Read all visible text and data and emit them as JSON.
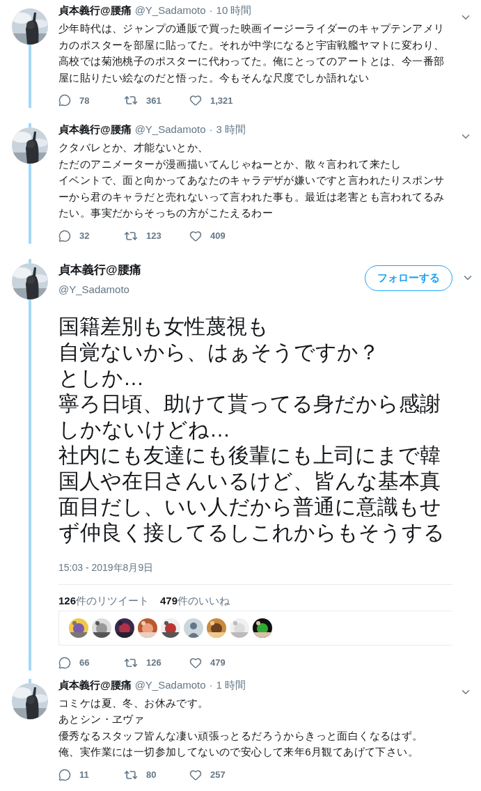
{
  "tweets": [
    {
      "kind": "reply",
      "name": "貞本義行@腰痛",
      "handle": "@Y_Sadamoto",
      "separator": "·",
      "time": "10 時間",
      "text": [
        "少年時代は、ジャンプの通販で買った映画イージーライダーのキャプテンアメリカのポスターを部屋に貼ってた。それが中学になると宇宙戦艦ヤマトに変わり、高校では菊池桃子のポスターに代わってた。俺にとってのアートとは、今一番部屋に貼りたい絵なのだと悟った。今もそんな尺度でしか語れない"
      ],
      "actions": {
        "replies": "78",
        "retweets": "361",
        "likes": "1,321"
      }
    },
    {
      "kind": "reply",
      "name": "貞本義行@腰痛",
      "handle": "@Y_Sadamoto",
      "separator": "·",
      "time": "3 時間",
      "text": [
        "クタバレとか、才能ないとか、",
        "ただのアニメーターが漫画描いてんじゃねーとか、散々言われて来たし",
        "イベントで、面と向かってあなたのキャラデザが嫌いですと言われたりスポンサーから君のキャラだと売れないって言われた事も。最近は老害とも言われてるみたい。事実だからそっちの方がこたえるわー"
      ],
      "actions": {
        "replies": "32",
        "retweets": "123",
        "likes": "409"
      }
    },
    {
      "kind": "main",
      "name": "貞本義行@腰痛",
      "handle": "@Y_Sadamoto",
      "follow_button": "フォローする",
      "text": [
        "国籍差別も女性蔑視も",
        "自覚ないから、はぁそうですか？",
        "としか…",
        "寧ろ日頃、助けて貰ってる身だから感謝しかないけどね…",
        "社内にも友達にも後輩にも上司にまで韓国人や在日さんいるけど、皆んな基本真面目だし、いい人だから普通に意識もせず仲良く接してるしこれからもそうする"
      ],
      "timestamp": "15:03 - 2019年8月9日",
      "stats": [
        "**126**件のリツイート",
        "**479**件のいいね"
      ],
      "likers": [
        {
          "kind": "picture"
        },
        {
          "kind": "picture"
        },
        {
          "kind": "picture"
        },
        {
          "kind": "picture"
        },
        {
          "kind": "picture"
        },
        {
          "kind": "default"
        },
        {
          "kind": "picture"
        },
        {
          "kind": "picture"
        },
        {
          "kind": "picture"
        }
      ],
      "actions": {
        "replies": "66",
        "retweets": "126",
        "likes": "479"
      }
    },
    {
      "kind": "reply",
      "name": "貞本義行@腰痛",
      "handle": "@Y_Sadamoto",
      "separator": "·",
      "time": "1 時間",
      "text": [
        "コミケは夏、冬、お休みです。",
        "あとシン・ヱヴァ",
        "優秀なるスタッフ皆んな凄い頑張っとるだろうからきっと面白くなるはず。",
        "俺、実作業には一切参加してないので安心して来年6月観てあげて下さい。"
      ],
      "actions": {
        "replies": "11",
        "retweets": "80",
        "likes": "257"
      }
    }
  ]
}
